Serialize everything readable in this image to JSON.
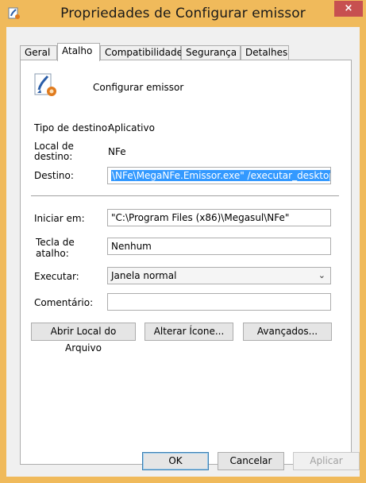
{
  "window": {
    "title": "Propriedades de Configurar emissor",
    "close_label": "×"
  },
  "tabs": [
    {
      "label": "Geral",
      "active": false
    },
    {
      "label": "Atalho",
      "active": true
    },
    {
      "label": "Compatibilidade",
      "active": false
    },
    {
      "label": "Segurança",
      "active": false
    },
    {
      "label": "Detalhes",
      "active": false
    }
  ],
  "shortcut": {
    "name": "Configurar emissor",
    "target_type_label": "Tipo de destino:",
    "target_type_value": "Aplicativo",
    "target_location_label_line1": "Local de",
    "target_location_label_line2": "destino:",
    "target_location_value": "NFe",
    "target_label": "Destino:",
    "target_value": "\\NFe\\MegaNFe.Emissor.exe\" /executar_desktop",
    "start_in_label": "Iniciar em:",
    "start_in_value": "\"C:\\Program Files (x86)\\Megasul\\NFe\"",
    "hotkey_label_line1": "Tecla de",
    "hotkey_label_line2": "atalho:",
    "hotkey_value": "Nenhum",
    "run_label": "Executar:",
    "run_value": "Janela normal",
    "comment_label": "Comentário:",
    "comment_value": ""
  },
  "buttons": {
    "open_location": "Abrir Local do Arquivo",
    "change_icon": "Alterar Ícone...",
    "advanced": "Avançados...",
    "ok": "OK",
    "cancel": "Cancelar",
    "apply": "Aplicar"
  },
  "colors": {
    "titlebar": "#f0ba5b",
    "close_button": "#c75050",
    "selection": "#3399ff"
  }
}
